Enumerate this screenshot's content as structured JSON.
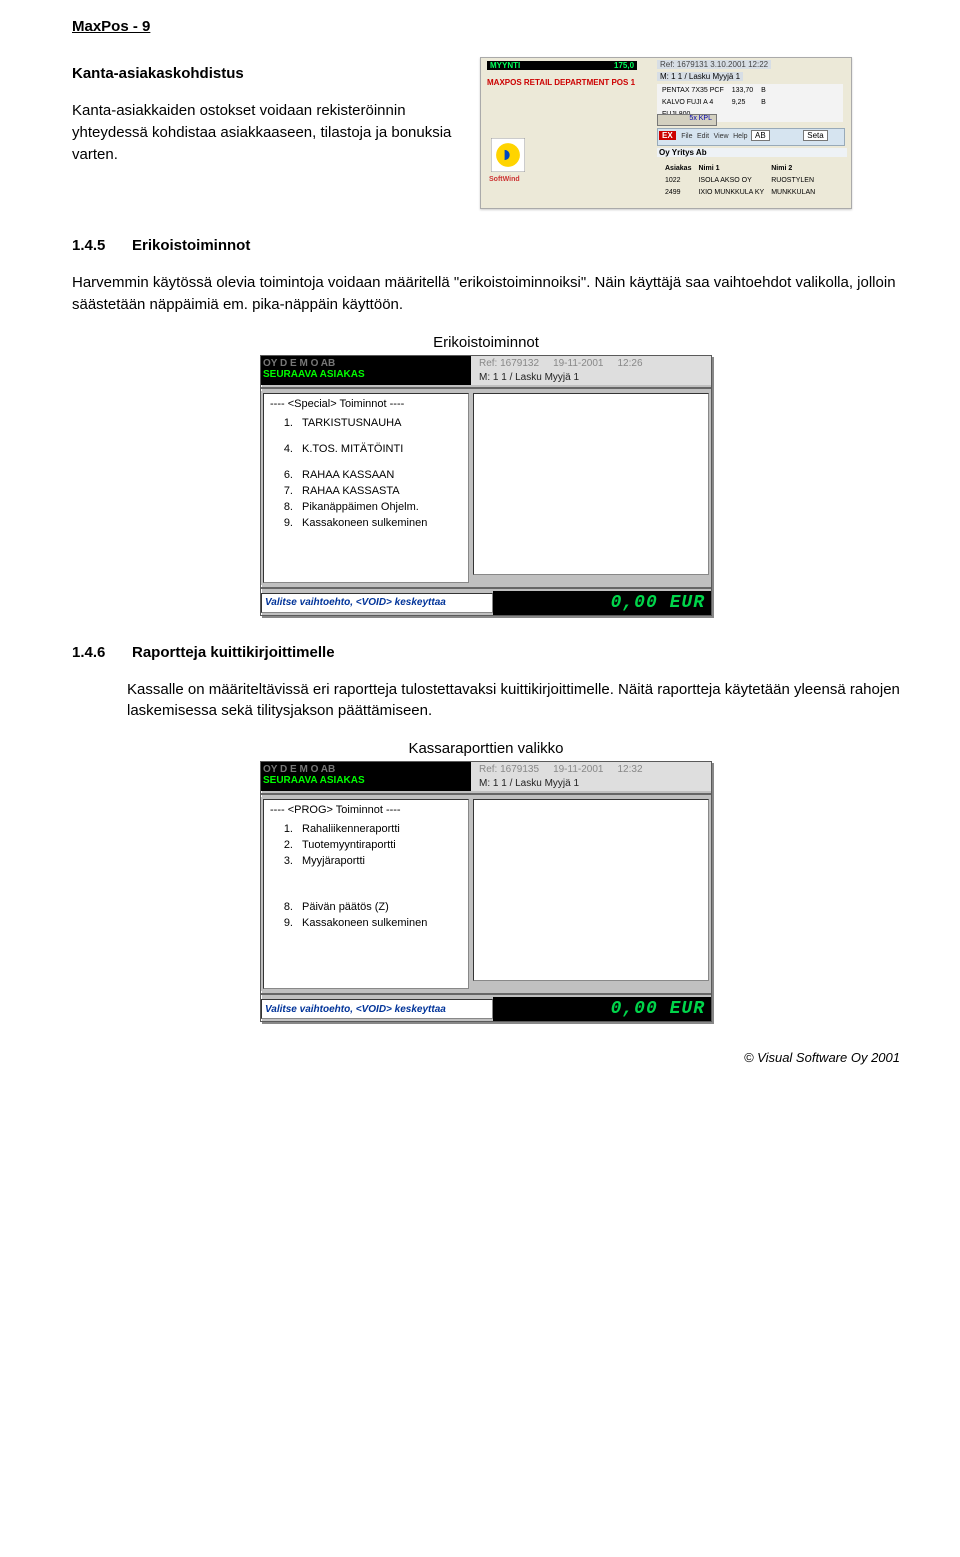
{
  "header": "MaxPos  -  9",
  "section_kanta": {
    "title": "Kanta-asiakaskohdistus",
    "para": "Kanta-asiakkaiden ostokset voidaan rekisteröinnin yhteydessä kohdistaa asiakkaaseen, tilastoja ja bonuksia varten."
  },
  "top_fig": {
    "ref": "Ref: 1679131   3.10.2001  12:22",
    "status": "M: 1  1 /  Lasku   Myyjä 1",
    "seller": "MYYNTI",
    "total": "175,0",
    "dept": "MAXPOS  RETAIL DEPARTMENT  POS 1",
    "kpl_label": "5x KPL",
    "menubar": {
      "file": "File",
      "edit": "Edit",
      "view": "View",
      "help": "Help"
    },
    "items": [
      {
        "name": "PENTAX 7X35 PCF",
        "price": "133,70",
        "u": "B"
      },
      {
        "name": "KALVO FUJI A 4",
        "price": "9,25",
        "u": "B"
      },
      {
        "name": "FUJI 800",
        "price": "",
        "u": ""
      }
    ],
    "ex": "EX",
    "ab": "AB",
    "seta": "Seta",
    "company": "Oy Yritys Ab",
    "col_a": "Asiakas",
    "col_n": "Nimi 1",
    "col_n2": "Nimi 2",
    "rows": [
      {
        "id": "1022",
        "n1": "ISOLA AKSO OY",
        "n2": "RUOSTYLEN"
      },
      {
        "id": "2499",
        "n1": "IXIO MUNKKULA KY",
        "n2": "MUNKKULAN"
      }
    ],
    "swlabel": "SoftWind"
  },
  "section_145": {
    "num": "1.4.5",
    "title": "Erikoistoiminnot",
    "para": "Harvemmin käytössä olevia toimintoja voidaan määritellä \"erikoistoiminnoiksi\". Näin käyttäjä saa vaihtoehdot valikolla, jolloin säästetään näppäimiä em. pika-näppäin käyttöön.",
    "caption": "Erikoistoiminnot",
    "fig": {
      "company": "OY D E M O  AB",
      "next": "SEURAAVA ASIAKAS",
      "ref": "Ref: 1679132",
      "date": "19-11-2001",
      "time": "12:26",
      "mline": "M: 1  1 /  Lasku    Myyjä 1",
      "list_header": "----   <Special>      Toiminnot ----",
      "items": [
        {
          "n": "1.",
          "t": "TARKISTUSNAUHA"
        },
        {
          "n": "",
          "t": ""
        },
        {
          "n": "4.",
          "t": "K.TOS. MITÄTÖINTI"
        },
        {
          "n": "",
          "t": ""
        },
        {
          "n": "6.",
          "t": "RAHAA KASSAAN"
        },
        {
          "n": "7.",
          "t": "RAHAA KASSASTA"
        },
        {
          "n": "8.",
          "t": "Pikanäppäimen Ohjelm."
        },
        {
          "n": "9.",
          "t": "Kassakoneen sulkeminen"
        }
      ],
      "prompt": "Valitse vaihtoehto, <VOID> keskeyttaa",
      "lcd": "0,00 EUR"
    }
  },
  "section_146": {
    "num": "1.4.6",
    "title": "Raportteja kuittikirjoittimelle",
    "para": "Kassalle on määriteltävissä eri raportteja tulostettavaksi kuittikirjoittimelle. Näitä raportteja käytetään yleensä rahojen laskemisessa sekä tilitysjakson päättämiseen.",
    "caption": "Kassaraporttien valikko",
    "fig": {
      "company": "OY D E M O  AB",
      "next": "SEURAAVA ASIAKAS",
      "ref": "Ref: 1679135",
      "date": "19-11-2001",
      "time": "12:32",
      "mline": "M: 1  1 /  Lasku    Myyjä 1",
      "list_header": "----   <PROG>        Toiminnot ----",
      "items": [
        {
          "n": "1.",
          "t": "Rahaliikenneraportti"
        },
        {
          "n": "2.",
          "t": "Tuotemyyntiraportti"
        },
        {
          "n": "3.",
          "t": "Myyjäraportti"
        },
        {
          "n": "",
          "t": ""
        },
        {
          "n": "",
          "t": ""
        },
        {
          "n": "",
          "t": ""
        },
        {
          "n": "8.",
          "t": "Päivän päätös (Z)"
        },
        {
          "n": "9.",
          "t": "Kassakoneen sulkeminen"
        }
      ],
      "prompt": "Valitse vaihtoehto, <VOID> keskeyttaa",
      "lcd": "0,00 EUR"
    }
  },
  "footer": "© Visual Software Oy 2001"
}
